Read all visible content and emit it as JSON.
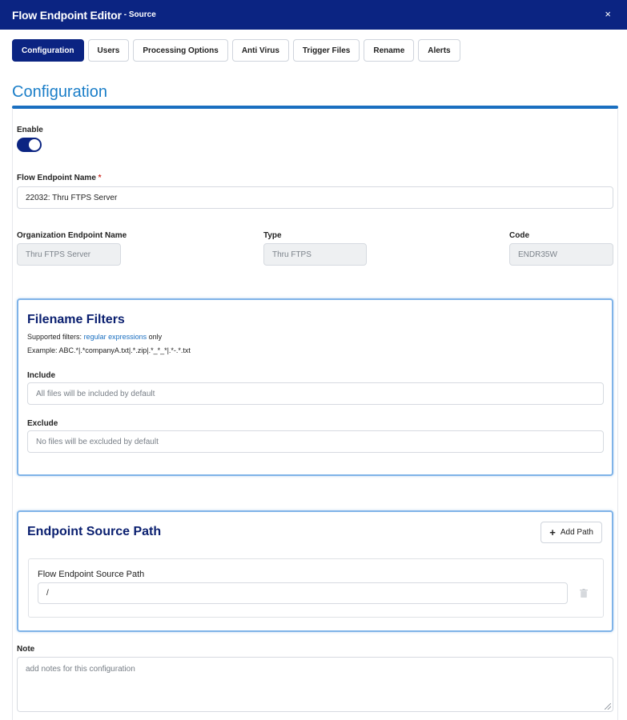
{
  "window": {
    "title": "Flow Endpoint Editor",
    "subtitle": "- Source",
    "close_icon": "×"
  },
  "tabs": [
    {
      "label": "Configuration",
      "active": true
    },
    {
      "label": "Users"
    },
    {
      "label": "Processing Options"
    },
    {
      "label": "Anti Virus"
    },
    {
      "label": "Trigger Files"
    },
    {
      "label": "Rename"
    },
    {
      "label": "Alerts"
    }
  ],
  "section": {
    "heading": "Configuration"
  },
  "form": {
    "enable_label": "Enable",
    "enable_on": true,
    "flow_endpoint_name_label": "Flow Endpoint Name",
    "required_mark": "*",
    "flow_endpoint_name_value": "22032: Thru FTPS Server",
    "org_endpoint_name_label": "Organization Endpoint Name",
    "org_endpoint_name_value": "Thru FTPS Server",
    "type_label": "Type",
    "type_value": "Thru FTPS",
    "code_label": "Code",
    "code_value": "ENDR35W"
  },
  "filename_filters": {
    "title": "Filename Filters",
    "supported_prefix": "Supported filters:",
    "supported_link": "regular expressions",
    "supported_suffix": "only",
    "example": "Example: ABC.*|.*companyA.txt|.*.zip|.*_*_*|.*-.*.txt",
    "include_label": "Include",
    "include_placeholder": "All files will be included by default",
    "exclude_label": "Exclude",
    "exclude_placeholder": "No files will be excluded by default"
  },
  "source_path": {
    "title": "Endpoint Source Path",
    "add_button_label": "Add Path",
    "plus_icon": "+",
    "path_label": "Flow Endpoint Source Path",
    "path_value": "/"
  },
  "note": {
    "label": "Note",
    "placeholder": "add notes for this configuration"
  },
  "colors": {
    "primary": "#0b2482",
    "accent": "#1a7ec8",
    "card_border": "#7fb3e8",
    "required": "#d0342c"
  }
}
